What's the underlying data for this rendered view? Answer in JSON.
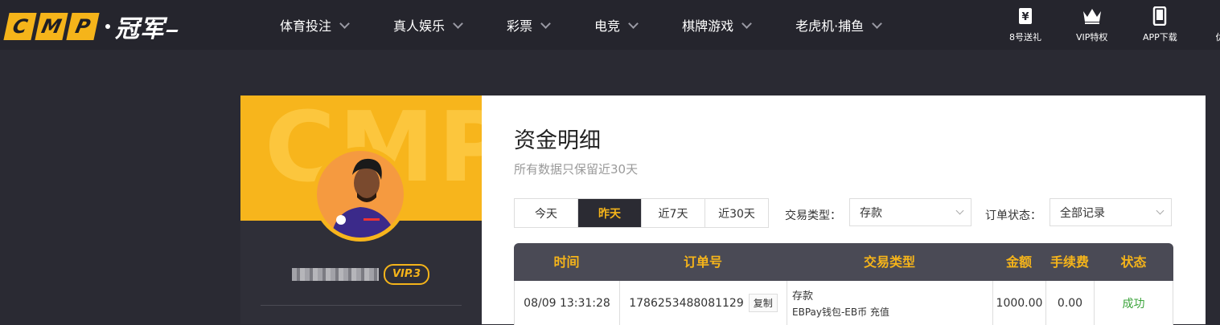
{
  "brand": {
    "logo_letters": [
      "C",
      "M",
      "P"
    ],
    "logo_cn": "冠军",
    "accent": "#f5b41a"
  },
  "nav": {
    "items": [
      {
        "label": "体育投注"
      },
      {
        "label": "真人娱乐"
      },
      {
        "label": "彩票"
      },
      {
        "label": "电竞"
      },
      {
        "label": "棋牌游戏"
      },
      {
        "label": "老虎机·捕鱼"
      }
    ]
  },
  "quick_links": [
    {
      "label": "8号送礼",
      "icon": "yen-icon"
    },
    {
      "label": "VIP特权",
      "icon": "crown-icon"
    },
    {
      "label": "APP下载",
      "icon": "phone-icon"
    },
    {
      "label": "优",
      "icon": "more-icon"
    }
  ],
  "profile": {
    "hero_bg_text": "CMP",
    "vip_badge": "VIP.3"
  },
  "page": {
    "title": "资金明细",
    "subtitle": "所有数据只保留近30天"
  },
  "filters": {
    "date_tabs": [
      {
        "label": "今天",
        "active": false
      },
      {
        "label": "昨天",
        "active": true
      },
      {
        "label": "近7天",
        "active": false
      },
      {
        "label": "近30天",
        "active": false
      }
    ],
    "type_label": "交易类型：",
    "type_value": "存款",
    "status_label": "订单状态：",
    "status_value": "全部记录"
  },
  "table": {
    "headers": [
      "时间",
      "订单号",
      "交易类型",
      "金额",
      "手续费",
      "状态"
    ],
    "rows": [
      {
        "time": "08/09 13:31:28",
        "order_no": "1786253488081129",
        "copy_label": "复制",
        "type_main": "存款",
        "type_detail": "EBPay钱包-EB币 充值",
        "amount": "1000.00",
        "fee": "0.00",
        "status": "成功"
      }
    ],
    "status_color": "#3aa33a"
  }
}
